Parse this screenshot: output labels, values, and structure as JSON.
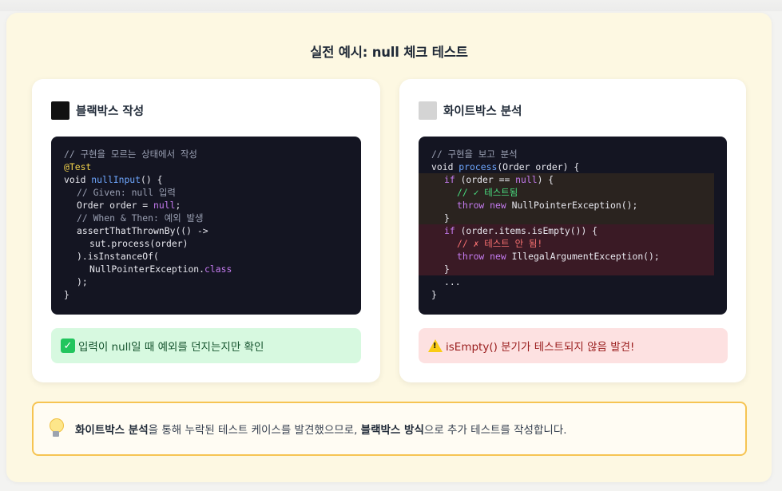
{
  "title": "실전 예시: null 체크 테스트",
  "left": {
    "heading": "블랙박스 작성",
    "code": {
      "l1": "// 구현을 모르는 상태에서 작성",
      "l2": "@Test",
      "l3a": "void ",
      "l3b": "nullInput",
      "l3c": "() {",
      "l4": "// Given: null 입력",
      "l5a": "Order order = ",
      "l5b": "null",
      "l5c": ";",
      "l6": "// When & Then: 예외 발생",
      "l7": "assertThatThrownBy(() ->",
      "l8": "sut.process(order)",
      "l9": ").isInstanceOf(",
      "l10a": "NullPointerException.",
      "l10b": "class",
      "l11": ");",
      "l12": "}"
    },
    "note": "입력이 null일 때 예외를 던지는지만 확인"
  },
  "right": {
    "heading": "화이트박스 분석",
    "code": {
      "l1": "// 구현을 보고 분석",
      "l2a": "void ",
      "l2b": "process",
      "l2c": "(Order order) {",
      "l3a": "if",
      "l3b": " (order == ",
      "l3c": "null",
      "l3d": ") {",
      "l4": "// ✓ 테스트됨",
      "l5a": "throw",
      "l5b": " ",
      "l5c": "new",
      "l5d": " NullPointerException();",
      "l6": "}",
      "l7a": "if",
      "l7b": " (order.items.isEmpty()) {",
      "l8": "// ✗ 테스트 안 됨!",
      "l9a": "throw",
      "l9b": " ",
      "l9c": "new",
      "l9d": " IllegalArgumentException();",
      "l10": "}",
      "l11": "...",
      "l12": "}"
    },
    "note": "isEmpty() 분기가 테스트되지 않음 발견!"
  },
  "tip": {
    "b1": "화이트박스 분석",
    "t1": "을 통해 누락된 테스트 케이스를 발견했으므로, ",
    "b2": "블랙박스 방식",
    "t2": "으로 추가 테스트를 작성합니다."
  },
  "icons": {
    "left_heading_icon": "black-square-icon",
    "right_heading_icon": "white-square-icon",
    "ok_icon": "check-box-icon",
    "warn_icon": "warning-icon",
    "tip_icon": "light-bulb-icon"
  }
}
